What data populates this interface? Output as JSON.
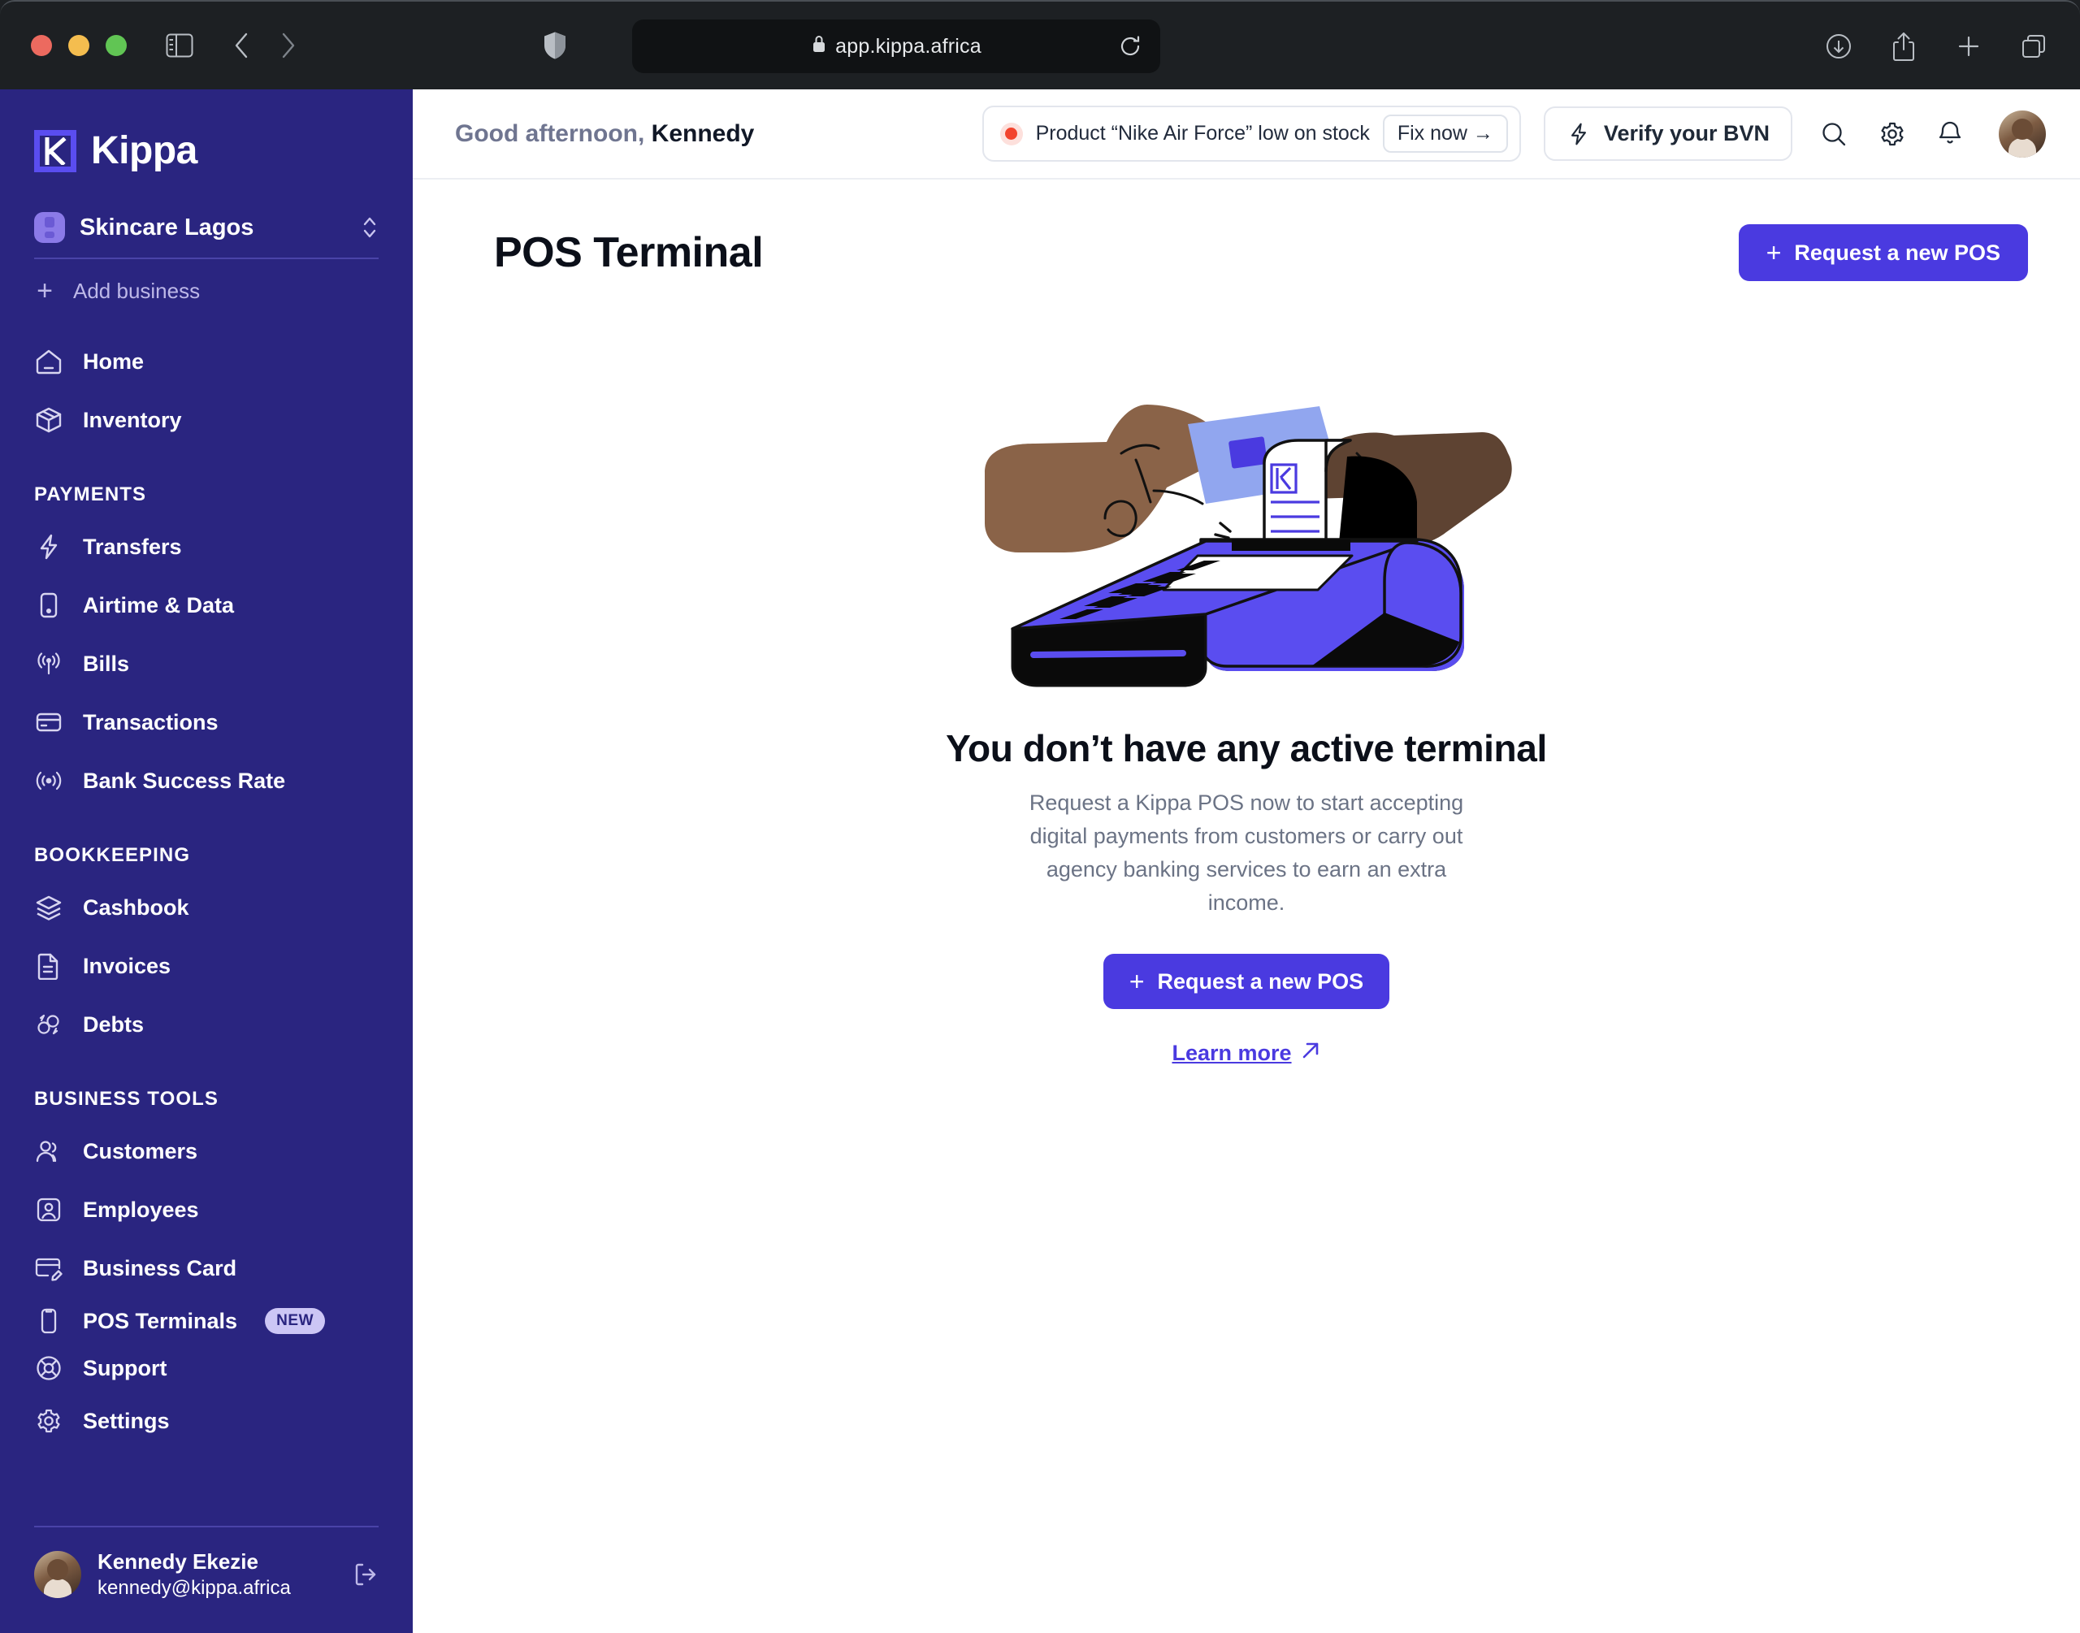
{
  "browser": {
    "url": "app.kippa.africa",
    "lock_icon": "lock-icon",
    "reload_icon": "reload-icon",
    "shield_icon": "shield-icon",
    "sidebar_toggle_icon": "sidebar-toggle-icon",
    "back_icon": "chevron-left-icon",
    "forward_icon": "chevron-right-icon",
    "downloads_icon": "download-icon",
    "share_icon": "share-icon",
    "new_tab_icon": "plus-icon",
    "tabs_icon": "tab-overview-icon"
  },
  "sidebar": {
    "logo_text": "Kippa",
    "business": {
      "name": "Skincare Lagos",
      "switch_icon": "chevron-up-down-icon",
      "add_label": "Add business",
      "add_icon": "plus-icon"
    },
    "groups": [
      {
        "title": "",
        "items": [
          {
            "label": "Home",
            "icon": "home-icon"
          },
          {
            "label": "Inventory",
            "icon": "box-icon"
          }
        ]
      },
      {
        "title": "PAYMENTS",
        "items": [
          {
            "label": "Transfers",
            "icon": "bolt-icon"
          },
          {
            "label": "Airtime & Data",
            "icon": "phone-icon"
          },
          {
            "label": "Bills",
            "icon": "broadcast-icon"
          },
          {
            "label": "Transactions",
            "icon": "card-icon"
          },
          {
            "label": "Bank Success Rate",
            "icon": "signal-icon"
          }
        ]
      },
      {
        "title": "BOOKKEEPING",
        "items": [
          {
            "label": "Cashbook",
            "icon": "layers-icon"
          },
          {
            "label": "Invoices",
            "icon": "document-icon"
          },
          {
            "label": "Debts",
            "icon": "debt-exchange-icon"
          }
        ]
      },
      {
        "title": "BUSINESS TOOLS",
        "items": [
          {
            "label": "Customers",
            "icon": "users-icon"
          },
          {
            "label": "Employees",
            "icon": "user-square-icon"
          },
          {
            "label": "Business Card",
            "icon": "card-edit-icon"
          },
          {
            "label": "POS Terminals",
            "icon": "mobile-icon",
            "badge": "NEW"
          },
          {
            "label": "Support",
            "icon": "lifebuoy-icon"
          },
          {
            "label": "Settings",
            "icon": "gear-icon"
          }
        ]
      }
    ],
    "user": {
      "name": "Kennedy Ekezie",
      "email": "kennedy@kippa.africa",
      "avatar_icon": "avatar",
      "logout_icon": "logout-icon"
    }
  },
  "topbar": {
    "greeting_prefix": "Good afternoon,",
    "greeting_name": "Kennedy",
    "stock_alert": {
      "text": "Product “Nike Air Force” low on stock",
      "action_label": "Fix now →",
      "dot_color": "#f2442e"
    },
    "bvn": {
      "label": "Verify your BVN",
      "icon": "bolt-icon"
    },
    "icons": [
      {
        "name": "search-icon"
      },
      {
        "name": "gear-icon"
      },
      {
        "name": "bell-icon"
      }
    ],
    "avatar_icon": "avatar"
  },
  "page": {
    "title": "POS Terminal",
    "primary_action": {
      "label": "Request a new POS",
      "icon": "plus-icon"
    }
  },
  "empty_state": {
    "illustration": "pos-terminal-payment-illustration",
    "title": "You don’t have any active terminal",
    "description": "Request a Kippa POS now to start accepting digital payments from customers or carry out agency banking services to earn an extra income.",
    "primary_action": {
      "label": "Request a new POS",
      "icon": "plus-icon"
    },
    "learn_more": {
      "label": "Learn more",
      "icon": "arrow-up-right-icon"
    }
  },
  "colors": {
    "sidebar_bg": "#2a2580",
    "accent": "#4a3ae0",
    "logo_mark": "#5a4df0",
    "alert": "#f2442e",
    "badge_bg": "#ccc6f5"
  }
}
